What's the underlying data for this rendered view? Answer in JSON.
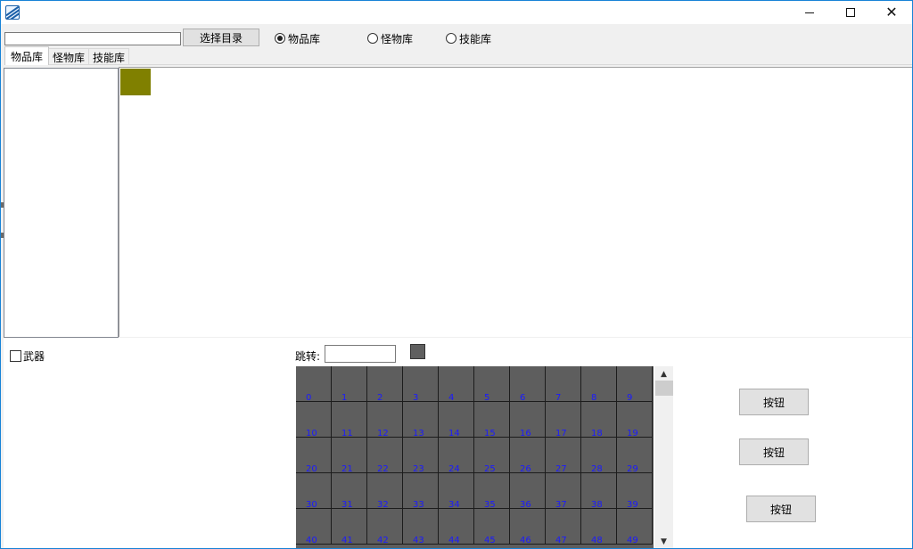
{
  "toolbar": {
    "path_value": "",
    "select_dir_label": "选择目录",
    "radios": [
      {
        "label": "物品库",
        "checked": true
      },
      {
        "label": "怪物库",
        "checked": false
      },
      {
        "label": "技能库",
        "checked": false
      }
    ]
  },
  "tabs": [
    {
      "label": "物品库",
      "active": true
    },
    {
      "label": "怪物库",
      "active": false
    },
    {
      "label": "技能库",
      "active": false
    }
  ],
  "preview": {
    "swatch_color": "#808000"
  },
  "filter": {
    "weapon_label": "武器",
    "weapon_checked": false
  },
  "jump": {
    "label": "跳转:",
    "value": "",
    "swatch_color": "#5f5f5f"
  },
  "grid": {
    "columns": 10,
    "cells": [
      "0",
      "1",
      "2",
      "3",
      "4",
      "5",
      "6",
      "7",
      "8",
      "9",
      "10",
      "11",
      "12",
      "13",
      "14",
      "15",
      "16",
      "17",
      "18",
      "19",
      "20",
      "21",
      "22",
      "23",
      "24",
      "25",
      "26",
      "27",
      "28",
      "29",
      "30",
      "31",
      "32",
      "33",
      "34",
      "35",
      "36",
      "37",
      "38",
      "39",
      "40",
      "41",
      "42",
      "43",
      "44",
      "45",
      "46",
      "47",
      "48",
      "49"
    ]
  },
  "buttons": [
    {
      "label": "按钮"
    },
    {
      "label": "按钮"
    },
    {
      "label": "按钮"
    }
  ],
  "icons": {
    "app": "app-icon",
    "minimize": "minimize-icon",
    "maximize": "maximize-icon",
    "close": "close-icon"
  }
}
